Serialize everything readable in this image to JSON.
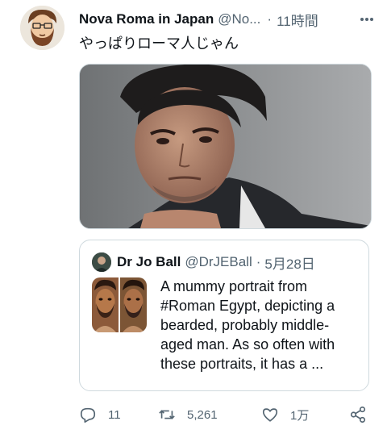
{
  "tweet": {
    "display_name": "Nova Roma in Japan",
    "handle": "@No...",
    "separator": "·",
    "time": "11時間",
    "text": "やっぱりローマ人じゃん"
  },
  "quote": {
    "display_name": "Dr Jo Ball",
    "handle": "@DrJEBall",
    "separator": "·",
    "date": "5月28日",
    "text": "A mummy portrait from #Roman Egypt, depicting a bearded, probably middle-aged man. As so often with these portraits, it has a ..."
  },
  "actions": {
    "reply_count": "11",
    "retweet_count": "5,261",
    "like_count": "1万"
  },
  "icons": {
    "more": "more-horizontal-icon",
    "reply": "reply-icon",
    "retweet": "retweet-icon",
    "like": "heart-icon",
    "share": "share-icon"
  },
  "colors": {
    "text_primary": "#0f1419",
    "text_secondary": "#536471",
    "border": "#cfd9de"
  }
}
